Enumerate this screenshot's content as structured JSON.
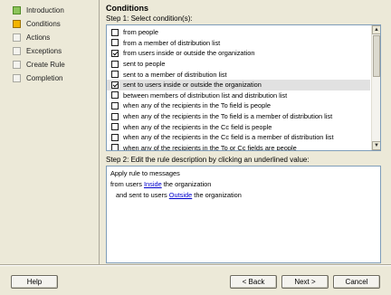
{
  "nav": {
    "items": [
      {
        "label": "Introduction",
        "state": "done"
      },
      {
        "label": "Conditions",
        "state": "current"
      },
      {
        "label": "Actions",
        "state": "todo"
      },
      {
        "label": "Exceptions",
        "state": "todo"
      },
      {
        "label": "Create Rule",
        "state": "todo"
      },
      {
        "label": "Completion",
        "state": "todo"
      }
    ]
  },
  "main": {
    "title": "Conditions",
    "step1_label": "Step 1: Select condition(s):",
    "step2_label": "Step 2: Edit the rule description by clicking an underlined value:"
  },
  "conditions": [
    {
      "label": "from people",
      "checked": false,
      "selected": false
    },
    {
      "label": "from a member of distribution list",
      "checked": false,
      "selected": false
    },
    {
      "label": "from users inside or outside the organization",
      "checked": true,
      "selected": false
    },
    {
      "label": "sent to people",
      "checked": false,
      "selected": false
    },
    {
      "label": "sent to a member of distribution list",
      "checked": false,
      "selected": false
    },
    {
      "label": "sent to users inside or outside the organization",
      "checked": true,
      "selected": true
    },
    {
      "label": "between members of distribution list and distribution list",
      "checked": false,
      "selected": false
    },
    {
      "label": "when any of the recipients in the To field is people",
      "checked": false,
      "selected": false
    },
    {
      "label": "when any of the recipients in the To field is a member of distribution list",
      "checked": false,
      "selected": false
    },
    {
      "label": "when any of the recipients in the Cc field is people",
      "checked": false,
      "selected": false
    },
    {
      "label": "when any of the recipients in the Cc field is a member of distribution list",
      "checked": false,
      "selected": false
    },
    {
      "label": "when any of the recipients in the To or Cc fields are people",
      "checked": false,
      "selected": false
    }
  ],
  "description": {
    "line1": "Apply rule to messages",
    "line2_prefix": "from users ",
    "line2_link": "Inside",
    "line2_suffix": " the organization",
    "line3_prefix": "and sent to users ",
    "line3_link": "Outside",
    "line3_suffix": " the organization"
  },
  "buttons": {
    "help": "Help",
    "back": "< Back",
    "next": "Next >",
    "cancel": "Cancel"
  },
  "scrollbar": {
    "up_icon": "▲",
    "down_icon": "▼"
  }
}
